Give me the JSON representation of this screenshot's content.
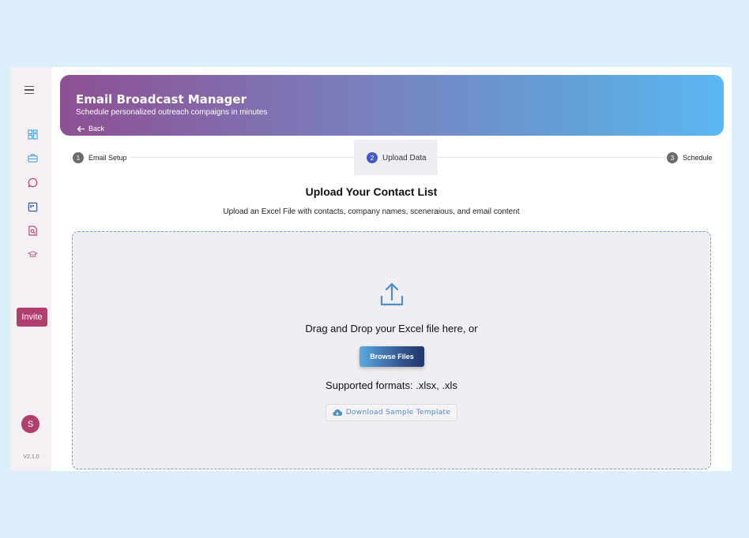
{
  "sidebar": {
    "icons": [
      "menu-icon",
      "dashboard-icon",
      "briefcase-icon",
      "chat-icon",
      "board-icon",
      "document-search-icon",
      "graduation-cap-icon"
    ],
    "invite_label": "Invite",
    "avatar_initial": "S",
    "version": "V2.1.0"
  },
  "banner": {
    "title": "Email Broadcast Manager",
    "subtitle": "Schedule personalized outreach compaigns in minutes",
    "back_label": "Back"
  },
  "stepper": {
    "steps": [
      {
        "number": "1",
        "label": "Email Setup",
        "active": false
      },
      {
        "number": "2",
        "label": "Upload Data",
        "active": true
      },
      {
        "number": "3",
        "label": "Schedule",
        "active": false
      }
    ]
  },
  "main": {
    "title": "Upload Your Contact List",
    "subtitle": "Upload an Excel File with contacts, company names, sceneraious, and email content",
    "dropzone": {
      "drop_text": "Drag and Drop your Excel file here, or",
      "browse_label": "Browse Files",
      "formats_text": "Supported formats: .xlsx, .xls",
      "template_label": "Download Sample Template"
    }
  },
  "colors": {
    "accent": "#b03e6f",
    "step_active": "#3f5cc4",
    "link": "#4a8ec4"
  }
}
